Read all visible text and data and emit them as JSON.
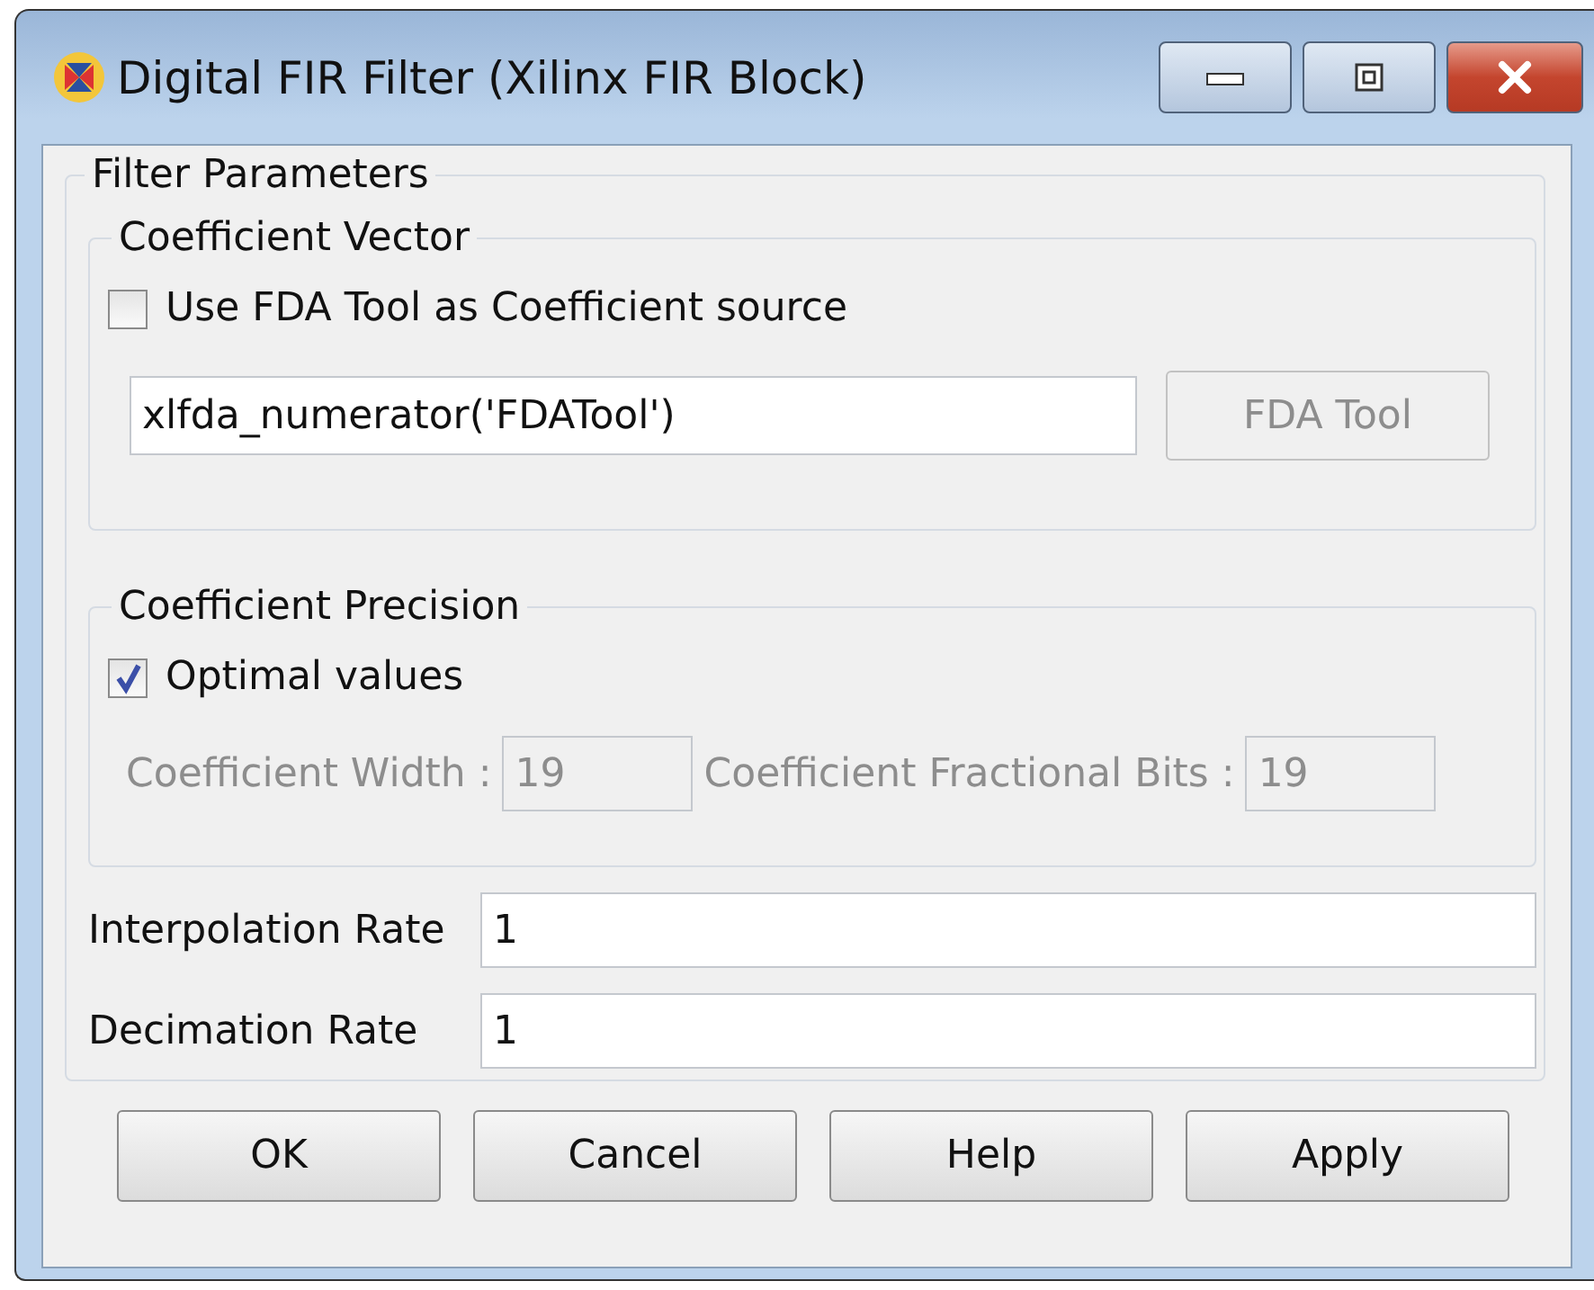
{
  "window": {
    "title": "Digital FIR Filter (Xilinx FIR Block)"
  },
  "filter_parameters": {
    "title": "Filter Parameters",
    "coefficient_vector": {
      "title": "Coefficient Vector",
      "use_fda_tool": {
        "label": "Use FDA Tool as Coefficient source",
        "checked": false
      },
      "coefficient_field": {
        "value": "xlfda_numerator('FDATool')"
      },
      "fda_tool_button": {
        "label": "FDA Tool",
        "disabled": true
      }
    },
    "coefficient_precision": {
      "title": "Coefficient Precision",
      "optimal_values": {
        "label": "Optimal values",
        "checked": true
      },
      "fields": [
        {
          "label": "Coefficient Width :",
          "value": "19",
          "disabled": true
        },
        {
          "label": "Coefficient Fractional Bits :",
          "value": "19",
          "disabled": true
        }
      ]
    },
    "rates": [
      {
        "label": "Interpolation Rate",
        "value": "1"
      },
      {
        "label": "Decimation Rate",
        "value": "1"
      }
    ]
  },
  "buttons": [
    "OK",
    "Cancel",
    "Help",
    "Apply"
  ]
}
